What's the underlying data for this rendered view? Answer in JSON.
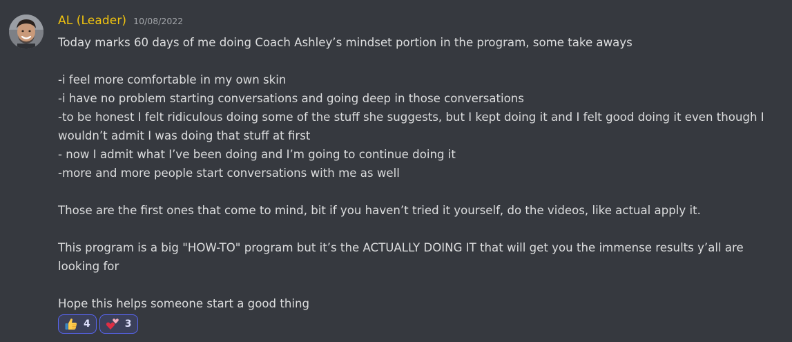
{
  "author": {
    "name": "AL (Leader)",
    "timestamp": "10/08/2022",
    "name_color": "#f1c40f"
  },
  "message": {
    "lines": [
      "Today marks 60 days of me doing Coach Ashley’s mindset portion in the program, some take aways",
      "",
      "-i feel more comfortable in my own skin",
      "-i have no problem starting conversations and going deep in those conversations",
      "-to be honest I felt ridiculous doing some of the stuff she suggests, but I kept doing it and I felt good doing it even though I wouldn’t admit I was doing that stuff at first",
      "- now I admit what I’ve been doing and I’m going to continue doing it",
      "-more and more people start conversations with me as well",
      "",
      "Those are the first ones that come to mind, bit if you haven’t tried it yourself, do the videos, like actual apply it.",
      "",
      "This program is a big \"HOW-TO\" program but it’s the ACTUALLY DOING IT that will get you the immense results y’all are looking for",
      "",
      "Hope this helps someone start a good thing"
    ]
  },
  "reactions": [
    {
      "emoji": "thumbs-up-icon",
      "count": "4"
    },
    {
      "emoji": "two-hearts-icon",
      "count": "3"
    }
  ],
  "colors": {
    "background": "#36393f",
    "text": "#dcddde",
    "timestamp": "#a3a6aa",
    "reaction_border": "#5865f2",
    "reaction_bg": "#3b405a"
  }
}
